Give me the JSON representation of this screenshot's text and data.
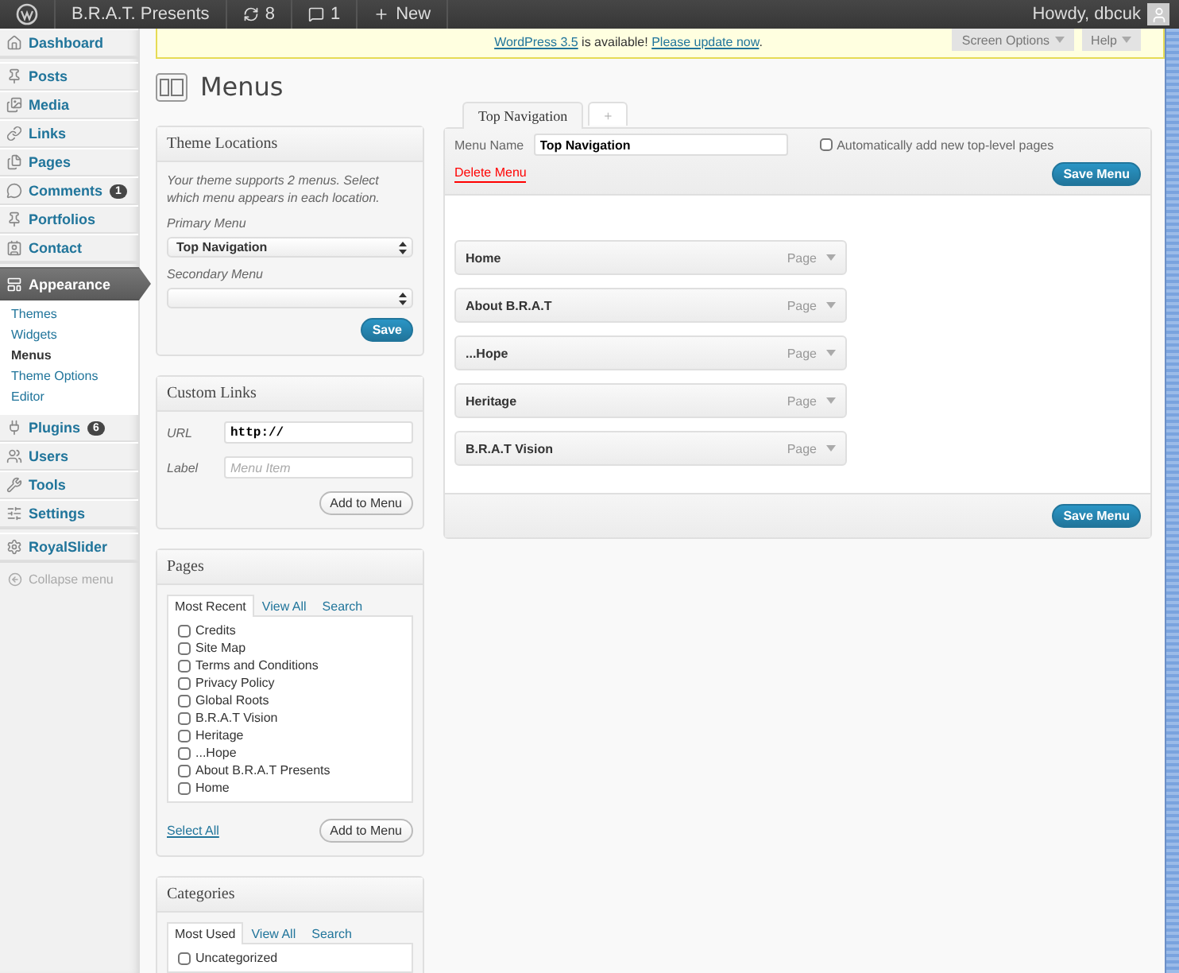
{
  "admin_bar": {
    "site": "B.R.A.T. Presents",
    "updates": "8",
    "comments": "1",
    "new": "New",
    "greeting": "Howdy, dbcuk"
  },
  "notice": {
    "version_link": "WordPress 3.5",
    "text": " is available! ",
    "update_link": "Please update now",
    "end": "."
  },
  "screen_tabs": [
    "Screen Options",
    "Help"
  ],
  "sidebar": {
    "groups": [
      [
        {
          "label": "Dashboard",
          "selected": false
        }
      ],
      [
        {
          "label": "Posts",
          "selected": false
        },
        {
          "label": "Media",
          "selected": false
        },
        {
          "label": "Links",
          "selected": false
        },
        {
          "label": "Pages",
          "selected": false
        },
        {
          "label": "Comments",
          "badge": "1",
          "selected": false
        },
        {
          "label": "Portfolios",
          "selected": false
        },
        {
          "label": "Contact",
          "selected": false
        }
      ],
      [
        {
          "label": "Appearance",
          "selected": true,
          "children": [
            {
              "label": "Themes",
              "selected": false
            },
            {
              "label": "Widgets",
              "selected": false
            },
            {
              "label": "Menus",
              "selected": true
            },
            {
              "label": "Theme Options",
              "selected": false
            },
            {
              "label": "Editor",
              "selected": false
            }
          ]
        },
        {
          "label": "Plugins",
          "badge": "6",
          "selected": false
        },
        {
          "label": "Users",
          "selected": false
        },
        {
          "label": "Tools",
          "selected": false
        },
        {
          "label": "Settings",
          "selected": false
        }
      ],
      [
        {
          "label": "RoyalSlider",
          "selected": false
        }
      ]
    ],
    "collapse": "Collapse menu"
  },
  "page_title": "Menus",
  "theme_locations": {
    "title": "Theme Locations",
    "description": "Your theme supports 2 menus. Select which menu appears in each location.",
    "fields": [
      {
        "label": "Primary Menu",
        "value": "Top Navigation"
      },
      {
        "label": "Secondary Menu"
      }
    ],
    "button": "Save"
  },
  "custom_links": {
    "title": "Custom Links",
    "url": {
      "label": "URL",
      "value": "http://"
    },
    "link_label": {
      "label": "Label",
      "placeholder": "Menu Item"
    },
    "button": "Add to Menu"
  },
  "pages": {
    "title": "Pages",
    "tabs": [
      {
        "label": "Most Recent",
        "selected": true
      },
      {
        "label": "View All",
        "selected": false
      },
      {
        "label": "Search",
        "selected": false
      }
    ],
    "items": [
      {
        "label": "Credits",
        "checked": false
      },
      {
        "label": "Site Map",
        "checked": false
      },
      {
        "label": "Terms and Conditions",
        "checked": false
      },
      {
        "label": "Privacy Policy",
        "checked": false
      },
      {
        "label": "Global Roots",
        "checked": false
      },
      {
        "label": "B.R.A.T Vision",
        "checked": false
      },
      {
        "label": "Heritage",
        "checked": false
      },
      {
        "label": "...Hope",
        "checked": false
      },
      {
        "label": "About B.R.A.T Presents",
        "checked": false
      },
      {
        "label": "Home",
        "checked": false
      }
    ],
    "select_all": "Select All",
    "button": "Add to Menu"
  },
  "categories": {
    "title": "Categories",
    "tabs": [
      {
        "label": "Most Used",
        "selected": true
      },
      {
        "label": "View All",
        "selected": false
      },
      {
        "label": "Search",
        "selected": false
      }
    ],
    "items": [
      {
        "label": "Uncategorized",
        "checked": false
      }
    ]
  },
  "menu_tabs": [
    {
      "label": "Top Navigation",
      "selected": true
    },
    {
      "label": "+",
      "selected": false
    }
  ],
  "menu_editor": {
    "name_label": "Menu Name",
    "name_value": "Top Navigation",
    "auto_add": {
      "label": "Automatically add new top-level pages",
      "checked": false
    },
    "delete": "Delete Menu",
    "save_top": "Save Menu",
    "save_bottom": "Save Menu",
    "items": [
      {
        "title": "Home",
        "type": "Page"
      },
      {
        "title": "About B.R.A.T",
        "type": "Page"
      },
      {
        "title": "...Hope",
        "type": "Page"
      },
      {
        "title": "Heritage",
        "type": "Page"
      },
      {
        "title": "B.R.A.T Vision",
        "type": "Page"
      }
    ]
  }
}
